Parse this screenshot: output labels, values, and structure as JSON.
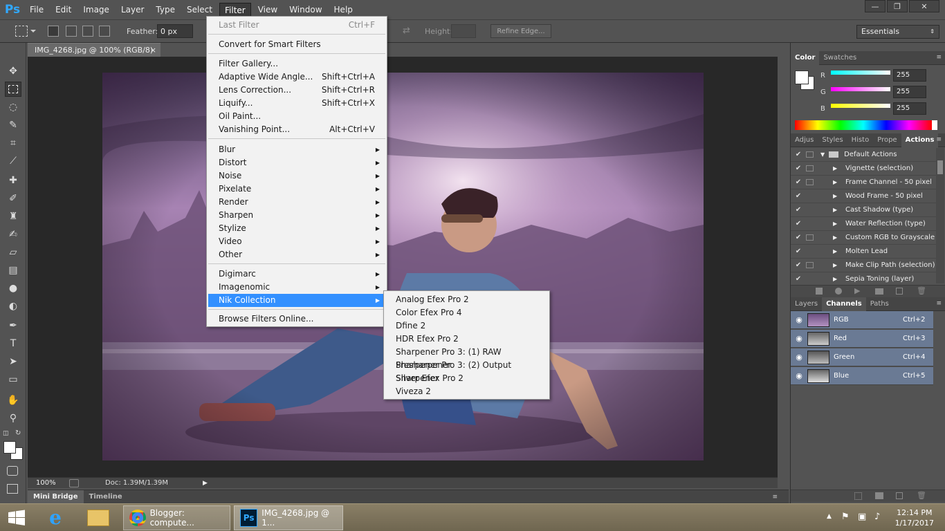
{
  "app": {
    "logo": "Ps"
  },
  "menubar": [
    "File",
    "Edit",
    "Image",
    "Layer",
    "Type",
    "Select",
    "Filter",
    "View",
    "Window",
    "Help"
  ],
  "window_buttons": {
    "minimize": "—",
    "restore": "❐",
    "close": "✕"
  },
  "options": {
    "feather_label": "Feather:",
    "feather_value": "0 px",
    "height_label": "Height:",
    "refine_edge": "Refine Edge...",
    "workspace": "Essentials"
  },
  "document": {
    "tab_title": "IMG_4268.jpg @ 100% (RGB/8)",
    "close": "×",
    "zoom": "100%",
    "doc_size": "Doc: 1.39M/1.39M"
  },
  "bottom_tabs": [
    "Mini Bridge",
    "Timeline"
  ],
  "color_panel": {
    "tabs": [
      "Color",
      "Swatches"
    ],
    "channels": [
      {
        "label": "R",
        "value": "255",
        "color": "#00ffff"
      },
      {
        "label": "G",
        "value": "255",
        "color": "#ff00ff"
      },
      {
        "label": "B",
        "value": "255",
        "color": "#ffff00"
      }
    ]
  },
  "actions_panel": {
    "tabs": [
      "Adjus",
      "Styles",
      "Histo",
      "Prope",
      "Actions"
    ],
    "items": [
      {
        "label": "Default Actions",
        "box": true
      },
      {
        "label": "Vignette (selection)",
        "box": true
      },
      {
        "label": "Frame Channel - 50 pixel",
        "box": true
      },
      {
        "label": "Wood Frame - 50 pixel",
        "box": false
      },
      {
        "label": "Cast Shadow (type)",
        "box": false
      },
      {
        "label": "Water Reflection (type)",
        "box": false
      },
      {
        "label": "Custom RGB to Grayscale",
        "box": true
      },
      {
        "label": "Molten Lead",
        "box": false
      },
      {
        "label": "Make Clip Path (selection)",
        "box": true
      },
      {
        "label": "Sepia Toning (layer)",
        "box": false
      }
    ]
  },
  "channels_panel": {
    "tabs": [
      "Layers",
      "Channels",
      "Paths"
    ],
    "items": [
      {
        "name": "RGB",
        "shortcut": "Ctrl+2"
      },
      {
        "name": "Red",
        "shortcut": "Ctrl+3"
      },
      {
        "name": "Green",
        "shortcut": "Ctrl+4"
      },
      {
        "name": "Blue",
        "shortcut": "Ctrl+5"
      }
    ]
  },
  "filter_menu": {
    "items": [
      {
        "label": "Last Filter",
        "shortcut": "Ctrl+F",
        "disabled": true
      },
      {
        "label": "Convert for Smart Filters"
      },
      {
        "label": "Filter Gallery..."
      },
      {
        "label": "Adaptive Wide Angle...",
        "shortcut": "Shift+Ctrl+A"
      },
      {
        "label": "Lens Correction...",
        "shortcut": "Shift+Ctrl+R"
      },
      {
        "label": "Liquify...",
        "shortcut": "Shift+Ctrl+X"
      },
      {
        "label": "Oil Paint..."
      },
      {
        "label": "Vanishing Point...",
        "shortcut": "Alt+Ctrl+V"
      },
      {
        "label": "Blur",
        "submenu": true
      },
      {
        "label": "Distort",
        "submenu": true
      },
      {
        "label": "Noise",
        "submenu": true
      },
      {
        "label": "Pixelate",
        "submenu": true
      },
      {
        "label": "Render",
        "submenu": true
      },
      {
        "label": "Sharpen",
        "submenu": true
      },
      {
        "label": "Stylize",
        "submenu": true
      },
      {
        "label": "Video",
        "submenu": true
      },
      {
        "label": "Other",
        "submenu": true
      },
      {
        "label": "Digimarc",
        "submenu": true
      },
      {
        "label": "Imagenomic",
        "submenu": true
      },
      {
        "label": "Nik Collection",
        "submenu": true,
        "highlighted": true
      },
      {
        "label": "Browse Filters Online..."
      }
    ]
  },
  "nik_submenu": [
    "Analog Efex Pro 2",
    "Color Efex Pro 4",
    "Dfine 2",
    "HDR Efex Pro 2",
    "Sharpener Pro 3: (1) RAW Presharpener",
    "Sharpener Pro 3: (2) Output Sharpener",
    "Silver Efex Pro 2",
    "Viveza 2"
  ],
  "taskbar": {
    "apps": [
      {
        "title": "Blogger: compute..."
      },
      {
        "title": "IMG_4268.jpg @ 1..."
      }
    ],
    "time": "12:14 PM",
    "date": "1/17/2017"
  }
}
